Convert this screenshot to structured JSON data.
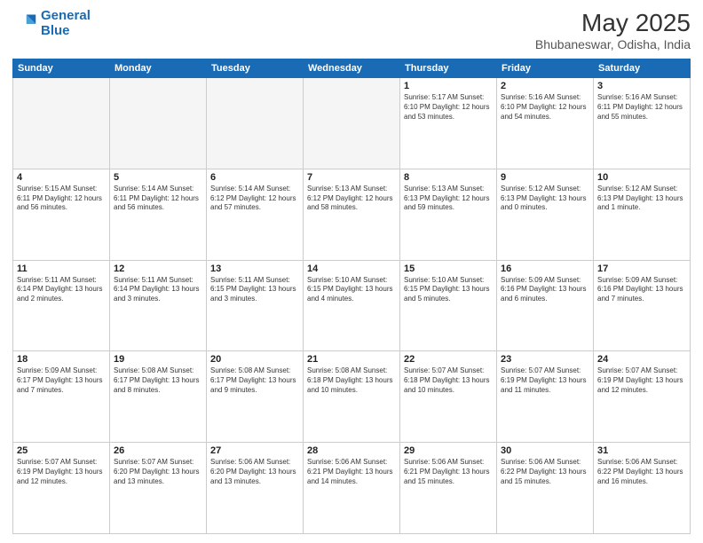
{
  "header": {
    "logo_line1": "General",
    "logo_line2": "Blue",
    "title": "May 2025",
    "subtitle": "Bhubaneswar, Odisha, India"
  },
  "weekdays": [
    "Sunday",
    "Monday",
    "Tuesday",
    "Wednesday",
    "Thursday",
    "Friday",
    "Saturday"
  ],
  "weeks": [
    [
      {
        "day": "",
        "info": "",
        "empty": true
      },
      {
        "day": "",
        "info": "",
        "empty": true
      },
      {
        "day": "",
        "info": "",
        "empty": true
      },
      {
        "day": "",
        "info": "",
        "empty": true
      },
      {
        "day": "1",
        "info": "Sunrise: 5:17 AM\nSunset: 6:10 PM\nDaylight: 12 hours\nand 53 minutes.",
        "empty": false
      },
      {
        "day": "2",
        "info": "Sunrise: 5:16 AM\nSunset: 6:10 PM\nDaylight: 12 hours\nand 54 minutes.",
        "empty": false
      },
      {
        "day": "3",
        "info": "Sunrise: 5:16 AM\nSunset: 6:11 PM\nDaylight: 12 hours\nand 55 minutes.",
        "empty": false
      }
    ],
    [
      {
        "day": "4",
        "info": "Sunrise: 5:15 AM\nSunset: 6:11 PM\nDaylight: 12 hours\nand 56 minutes.",
        "empty": false
      },
      {
        "day": "5",
        "info": "Sunrise: 5:14 AM\nSunset: 6:11 PM\nDaylight: 12 hours\nand 56 minutes.",
        "empty": false
      },
      {
        "day": "6",
        "info": "Sunrise: 5:14 AM\nSunset: 6:12 PM\nDaylight: 12 hours\nand 57 minutes.",
        "empty": false
      },
      {
        "day": "7",
        "info": "Sunrise: 5:13 AM\nSunset: 6:12 PM\nDaylight: 12 hours\nand 58 minutes.",
        "empty": false
      },
      {
        "day": "8",
        "info": "Sunrise: 5:13 AM\nSunset: 6:13 PM\nDaylight: 12 hours\nand 59 minutes.",
        "empty": false
      },
      {
        "day": "9",
        "info": "Sunrise: 5:12 AM\nSunset: 6:13 PM\nDaylight: 13 hours\nand 0 minutes.",
        "empty": false
      },
      {
        "day": "10",
        "info": "Sunrise: 5:12 AM\nSunset: 6:13 PM\nDaylight: 13 hours\nand 1 minute.",
        "empty": false
      }
    ],
    [
      {
        "day": "11",
        "info": "Sunrise: 5:11 AM\nSunset: 6:14 PM\nDaylight: 13 hours\nand 2 minutes.",
        "empty": false
      },
      {
        "day": "12",
        "info": "Sunrise: 5:11 AM\nSunset: 6:14 PM\nDaylight: 13 hours\nand 3 minutes.",
        "empty": false
      },
      {
        "day": "13",
        "info": "Sunrise: 5:11 AM\nSunset: 6:15 PM\nDaylight: 13 hours\nand 3 minutes.",
        "empty": false
      },
      {
        "day": "14",
        "info": "Sunrise: 5:10 AM\nSunset: 6:15 PM\nDaylight: 13 hours\nand 4 minutes.",
        "empty": false
      },
      {
        "day": "15",
        "info": "Sunrise: 5:10 AM\nSunset: 6:15 PM\nDaylight: 13 hours\nand 5 minutes.",
        "empty": false
      },
      {
        "day": "16",
        "info": "Sunrise: 5:09 AM\nSunset: 6:16 PM\nDaylight: 13 hours\nand 6 minutes.",
        "empty": false
      },
      {
        "day": "17",
        "info": "Sunrise: 5:09 AM\nSunset: 6:16 PM\nDaylight: 13 hours\nand 7 minutes.",
        "empty": false
      }
    ],
    [
      {
        "day": "18",
        "info": "Sunrise: 5:09 AM\nSunset: 6:17 PM\nDaylight: 13 hours\nand 7 minutes.",
        "empty": false
      },
      {
        "day": "19",
        "info": "Sunrise: 5:08 AM\nSunset: 6:17 PM\nDaylight: 13 hours\nand 8 minutes.",
        "empty": false
      },
      {
        "day": "20",
        "info": "Sunrise: 5:08 AM\nSunset: 6:17 PM\nDaylight: 13 hours\nand 9 minutes.",
        "empty": false
      },
      {
        "day": "21",
        "info": "Sunrise: 5:08 AM\nSunset: 6:18 PM\nDaylight: 13 hours\nand 10 minutes.",
        "empty": false
      },
      {
        "day": "22",
        "info": "Sunrise: 5:07 AM\nSunset: 6:18 PM\nDaylight: 13 hours\nand 10 minutes.",
        "empty": false
      },
      {
        "day": "23",
        "info": "Sunrise: 5:07 AM\nSunset: 6:19 PM\nDaylight: 13 hours\nand 11 minutes.",
        "empty": false
      },
      {
        "day": "24",
        "info": "Sunrise: 5:07 AM\nSunset: 6:19 PM\nDaylight: 13 hours\nand 12 minutes.",
        "empty": false
      }
    ],
    [
      {
        "day": "25",
        "info": "Sunrise: 5:07 AM\nSunset: 6:19 PM\nDaylight: 13 hours\nand 12 minutes.",
        "empty": false
      },
      {
        "day": "26",
        "info": "Sunrise: 5:07 AM\nSunset: 6:20 PM\nDaylight: 13 hours\nand 13 minutes.",
        "empty": false
      },
      {
        "day": "27",
        "info": "Sunrise: 5:06 AM\nSunset: 6:20 PM\nDaylight: 13 hours\nand 13 minutes.",
        "empty": false
      },
      {
        "day": "28",
        "info": "Sunrise: 5:06 AM\nSunset: 6:21 PM\nDaylight: 13 hours\nand 14 minutes.",
        "empty": false
      },
      {
        "day": "29",
        "info": "Sunrise: 5:06 AM\nSunset: 6:21 PM\nDaylight: 13 hours\nand 15 minutes.",
        "empty": false
      },
      {
        "day": "30",
        "info": "Sunrise: 5:06 AM\nSunset: 6:22 PM\nDaylight: 13 hours\nand 15 minutes.",
        "empty": false
      },
      {
        "day": "31",
        "info": "Sunrise: 5:06 AM\nSunset: 6:22 PM\nDaylight: 13 hours\nand 16 minutes.",
        "empty": false
      }
    ]
  ]
}
